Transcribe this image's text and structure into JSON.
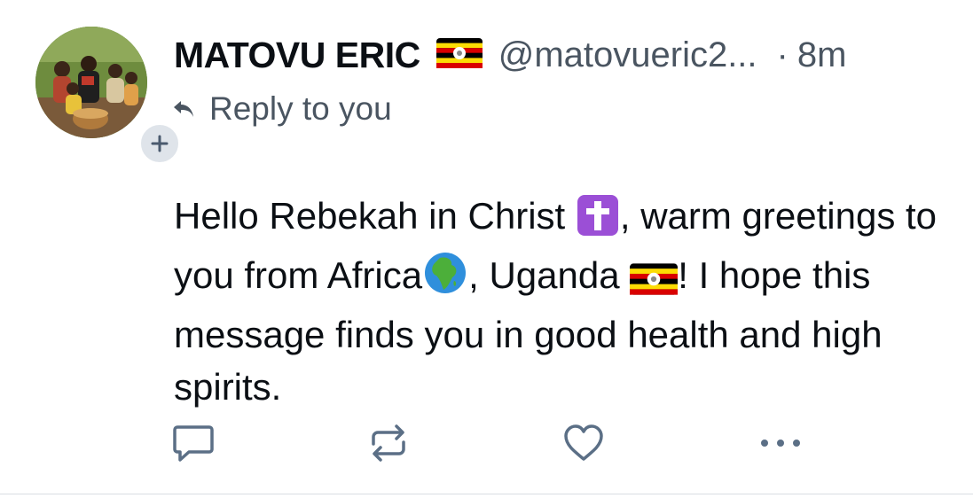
{
  "post": {
    "author": {
      "display_name": "MATOVU ERIC",
      "handle": "@matovueric2...",
      "flag_icon": "uganda-flag-icon",
      "avatar_icon": "profile-photo"
    },
    "separator": "·",
    "time": "8m",
    "reply_to": "Reply to you",
    "text": {
      "part1": "Hello Rebekah in Christ ",
      "part2": ", warm greetings to you from Africa",
      "part3": ", Uganda ",
      "part4": "! I hope this message finds you in good health and high spirits."
    }
  },
  "actions": {
    "reply_icon": "comment-icon",
    "repost_icon": "repost-icon",
    "like_icon": "heart-icon",
    "more_icon": "more-dots-icon"
  },
  "colors": {
    "text": "#0b0f14",
    "muted": "#4a5561",
    "icon": "#5b6f86",
    "divider": "#d9dde2",
    "badge_bg": "#dfe4ea"
  }
}
